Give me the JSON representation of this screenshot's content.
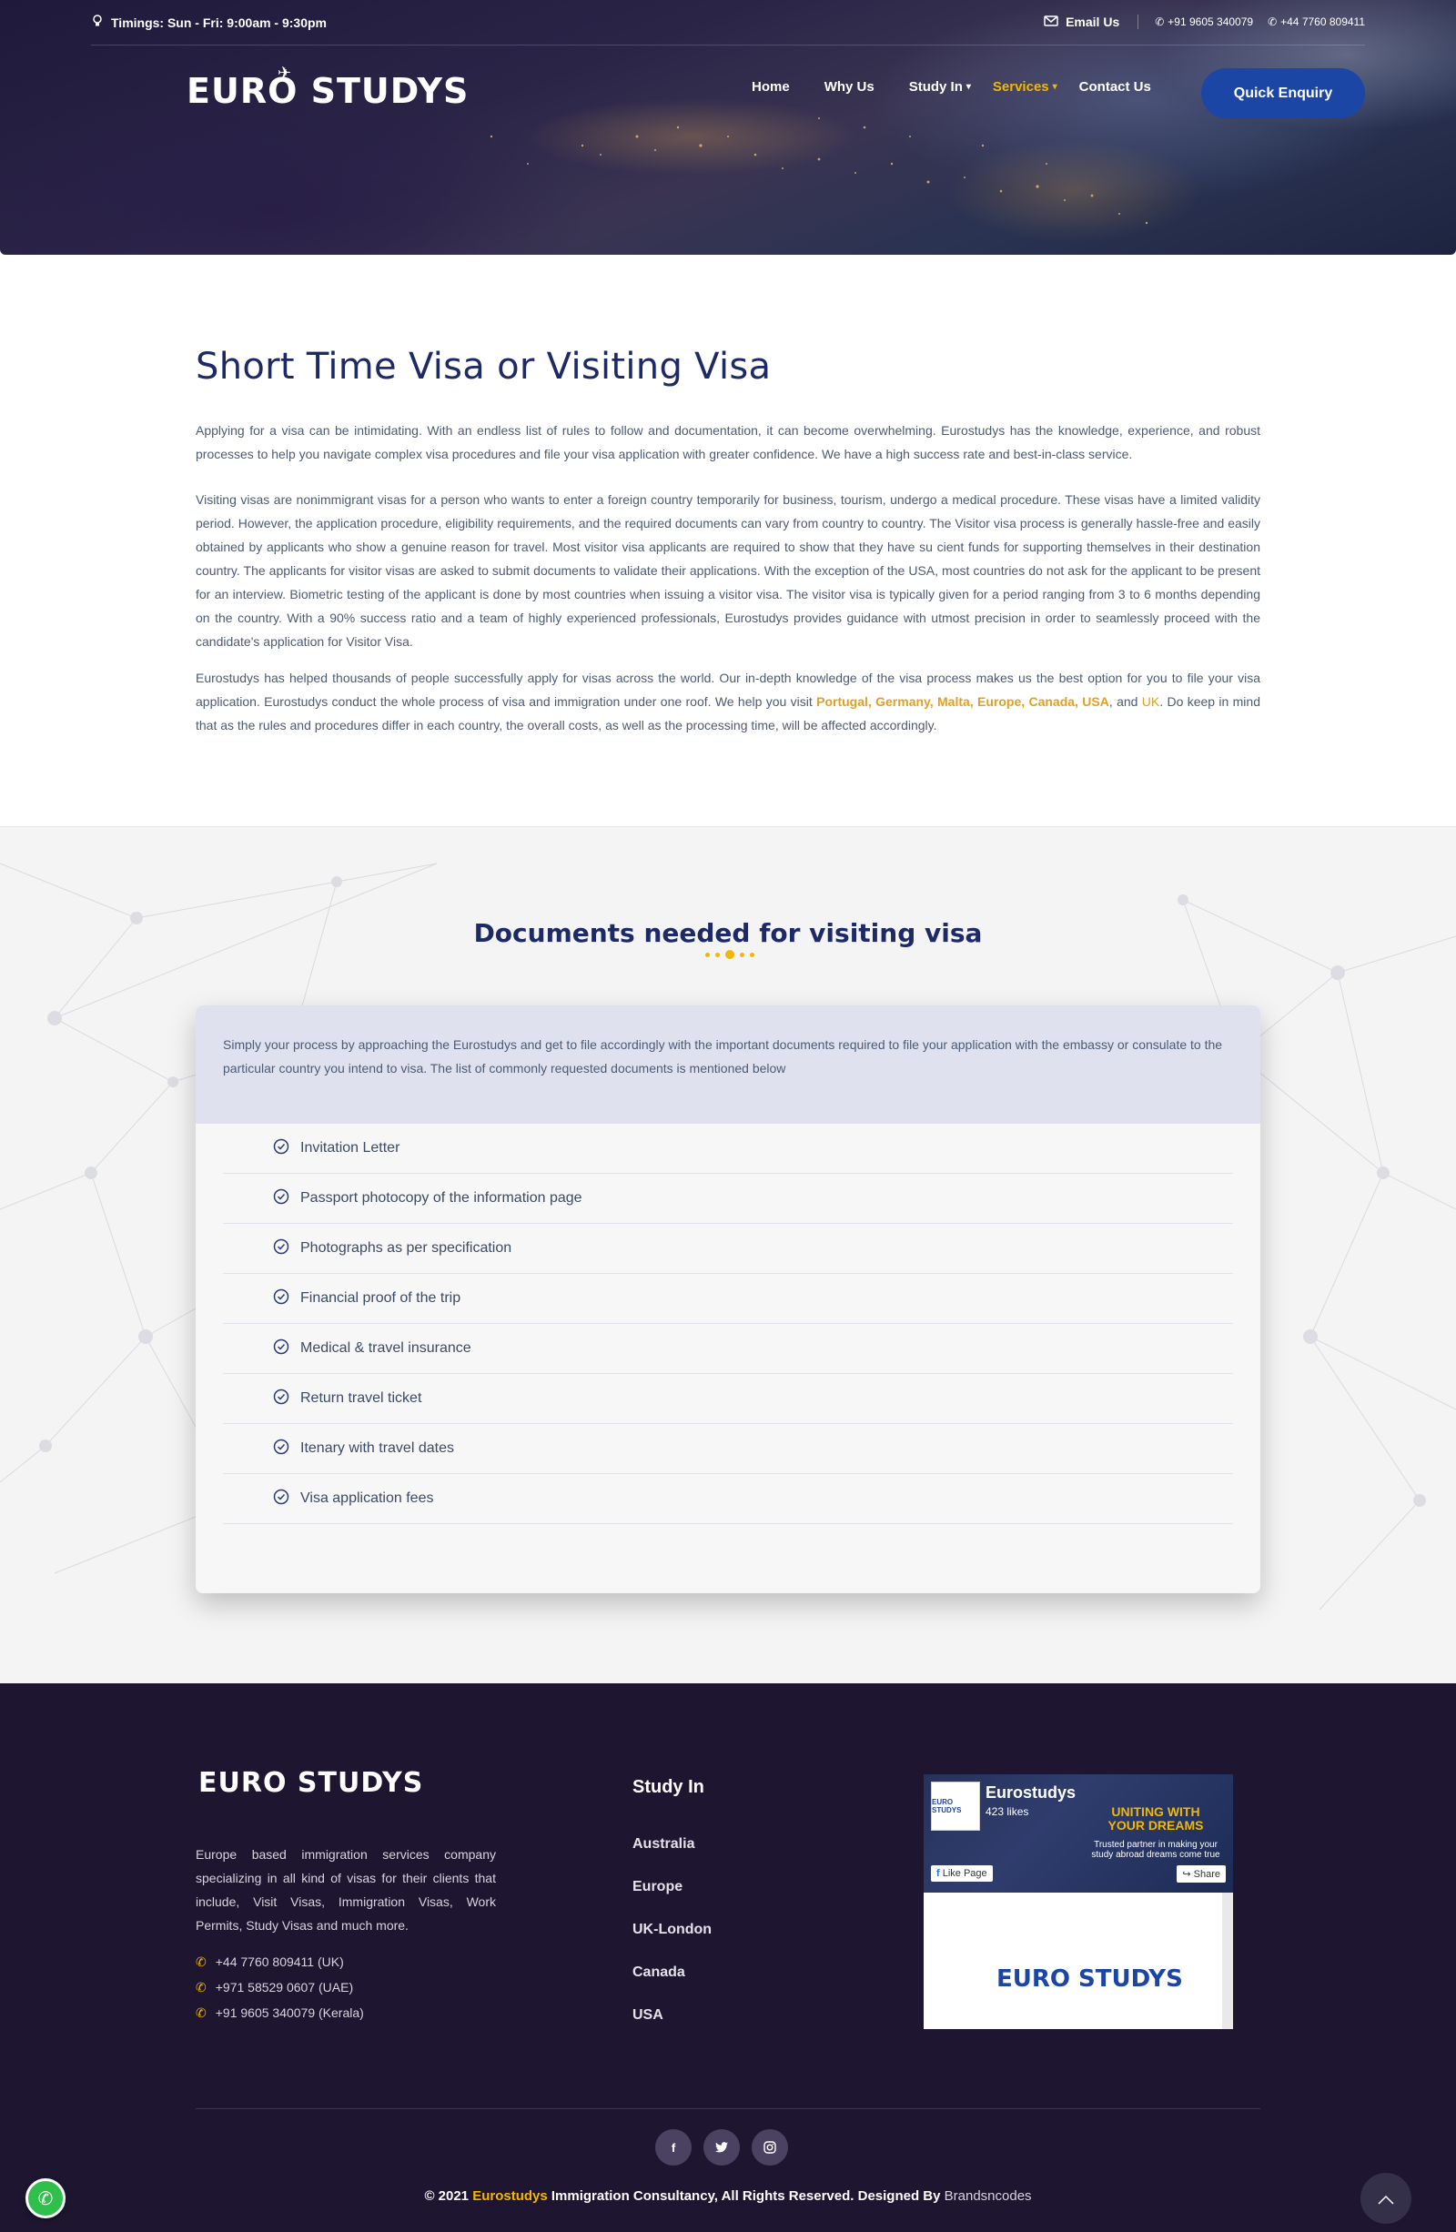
{
  "topbar": {
    "timings": "Timings: Sun - Fri: 9:00am - 9:30pm",
    "email_label": "Email Us",
    "phone_1": "+91 9605 340079",
    "phone_2": "+44 7760 809411"
  },
  "header": {
    "logo_text": "EURO STUDYS",
    "nav": [
      {
        "label": "Home"
      },
      {
        "label": "Why Us"
      },
      {
        "label": "Study In"
      },
      {
        "label": "Services"
      },
      {
        "label": "Contact Us"
      }
    ],
    "enquiry_label": "Quick Enquiry"
  },
  "content": {
    "title": "Short Time Visa or Visiting Visa",
    "p1": "Applying for a visa can be intimidating. With an endless list of rules to follow and documentation, it can become overwhelming. Eurostudys has the knowledge, experience, and robust processes to help you navigate complex visa procedures and file your visa application with greater confidence. We have a high success rate and best-in-class service.",
    "p2": "Visiting visas are nonimmigrant visas for a person who wants to enter a foreign country temporarily for business, tourism, undergo a medical procedure. These visas have a limited validity period. However, the application procedure, eligibility requirements, and the required documents can vary from country to country. The Visitor visa process is generally hassle-free and easily obtained by applicants who show a genuine reason for travel. Most visitor visa applicants are required to show that they have su   cient funds for supporting themselves in their destination country. The applicants for visitor visas are asked to submit documents to validate their applications. With the exception of the USA, most countries do not ask for the applicant to be present for an interview. Biometric testing of the applicant is done by most countries when issuing a visitor visa. The visitor visa is typically given for a period ranging from 3 to 6 months depending on the country. With a 90% success ratio and a team of highly experienced professionals, Eurostudys provides guidance with utmost precision in order to seamlessly proceed with the candidate's application for Visitor Visa.",
    "p3_start": "Eurostudys has helped thousands of people successfully apply for visas across the world. Our in-depth knowledge of the visa process makes us the best option for you to file your visa application. Eurostudys conduct the whole process of visa and immigration under one roof. We help you visit ",
    "p3_countries": "Portugal, Germany, Malta, Europe, Canada, USA",
    "p3_and": ", and ",
    "p3_uk": "UK",
    "p3_end": ". Do keep in mind that as the rules and procedures differ in each country, the overall costs, as well as the processing time, will be affected accordingly."
  },
  "docs": {
    "title": "Documents needed for visiting visa",
    "intro": "Simply your process by approaching the Eurostudys and get to file accordingly with the important documents required to file your application with the embassy or consulate to the particular country you intend to visa. The list of commonly requested documents is mentioned below",
    "items": [
      "Invitation Letter",
      "Passport photocopy of the information page",
      "Photographs as per specification",
      "Financial proof of the trip",
      "Medical & travel insurance",
      "Return travel ticket",
      "Itenary with travel dates",
      "Visa application fees"
    ]
  },
  "footer": {
    "logo_text": "EURO STUDYS",
    "about": "Europe based immigration services company specializing in all kind of visas for their clients that include, Visit Visas, Immigration Visas, Work Permits, Study Visas and much more.",
    "phones": [
      "+44 7760 809411 (UK)",
      "+971 58529 0607 (UAE)",
      "+91 9605 340079 (Kerala)"
    ],
    "study_title": "Study In",
    "study_links": [
      "Australia",
      "Europe",
      "UK-London",
      "Canada",
      "USA"
    ],
    "fb": {
      "name": "Eurostudys",
      "likes": "423 likes",
      "slogan": "UNITING WITH YOUR DREAMS",
      "tagline": "Trusted partner in making your study abroad dreams come true",
      "like_btn": "Like Page",
      "share_btn": "Share",
      "body_logo": "EURO STUDYS",
      "thumb_text": "EURO STUDYS"
    },
    "copyright_pre": "© 2021 ",
    "copyright_brand": "Eurostudys",
    "copyright_mid": " Immigration Consultancy, All Rights Reserved. Designed By ",
    "copyright_designer": "Brandsncodes"
  },
  "colors": {
    "accent": "#f2b705",
    "primary_button": "#1c46a5",
    "heading": "#1d2a66",
    "footer_bg": "#1e1631"
  },
  "icons": [
    "bulb-icon",
    "mail-icon",
    "phone-icon",
    "check-circle-icon",
    "facebook-icon",
    "twitter-icon",
    "instagram-icon",
    "arrow-up-icon",
    "whatsapp-icon"
  ]
}
